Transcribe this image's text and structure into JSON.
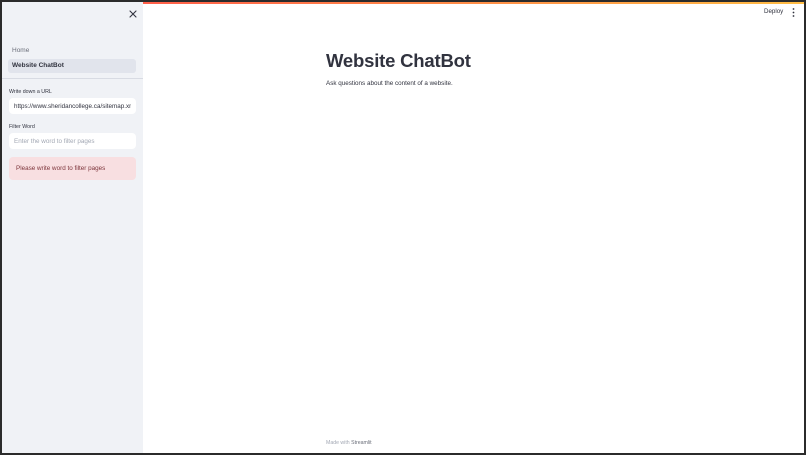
{
  "sidebar": {
    "nav_items": [
      {
        "label": "Home",
        "active": false
      },
      {
        "label": "Website ChatBot",
        "active": true
      }
    ],
    "url_field": {
      "label": "Write down a URL",
      "value": "https://www.sheridancollege.ca/sitemap.xml"
    },
    "filter_field": {
      "label": "Filter Word",
      "placeholder": "Enter the word to filter pages",
      "value": ""
    },
    "alert_text": "Please write word to filter pages"
  },
  "header": {
    "deploy_label": "Deploy",
    "menu_icon": "vertical-ellipsis-icon",
    "close_icon": "close-icon"
  },
  "main": {
    "title": "Website ChatBot",
    "subtitle": "Ask questions about the content of a website."
  },
  "footer": {
    "made_with": "Made with",
    "brand": "Streamlit"
  },
  "colors": {
    "sidebar_bg": "#f0f2f6",
    "alert_bg": "#f8dfe1",
    "alert_text": "#7d353b",
    "accent_gradient_start": "#ff4b4b",
    "accent_gradient_end": "#ffbd45"
  }
}
